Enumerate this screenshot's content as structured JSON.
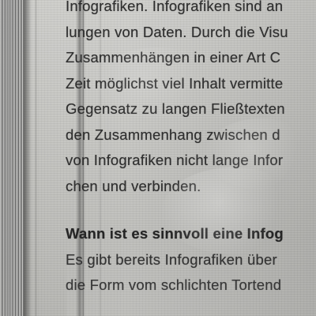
{
  "paragraph_lines": [
    "Infografiken. Infografiken sind an",
    "lungen von Daten. Durch die Visu",
    "Zusammenhängen in einer Art C",
    "Zeit möglichst viel Inhalt vermitte",
    "Gegensatz zu langen Fließtexten",
    "den Zusammenhang zwischen d",
    "von Infografiken nicht lange Infor",
    "chen und verbinden."
  ],
  "heading": "Wann ist es sinnvoll eine Infog",
  "paragraph2_lines": [
    "Es gibt bereits Infografiken über",
    "die Form vom schlichten Tortend"
  ]
}
